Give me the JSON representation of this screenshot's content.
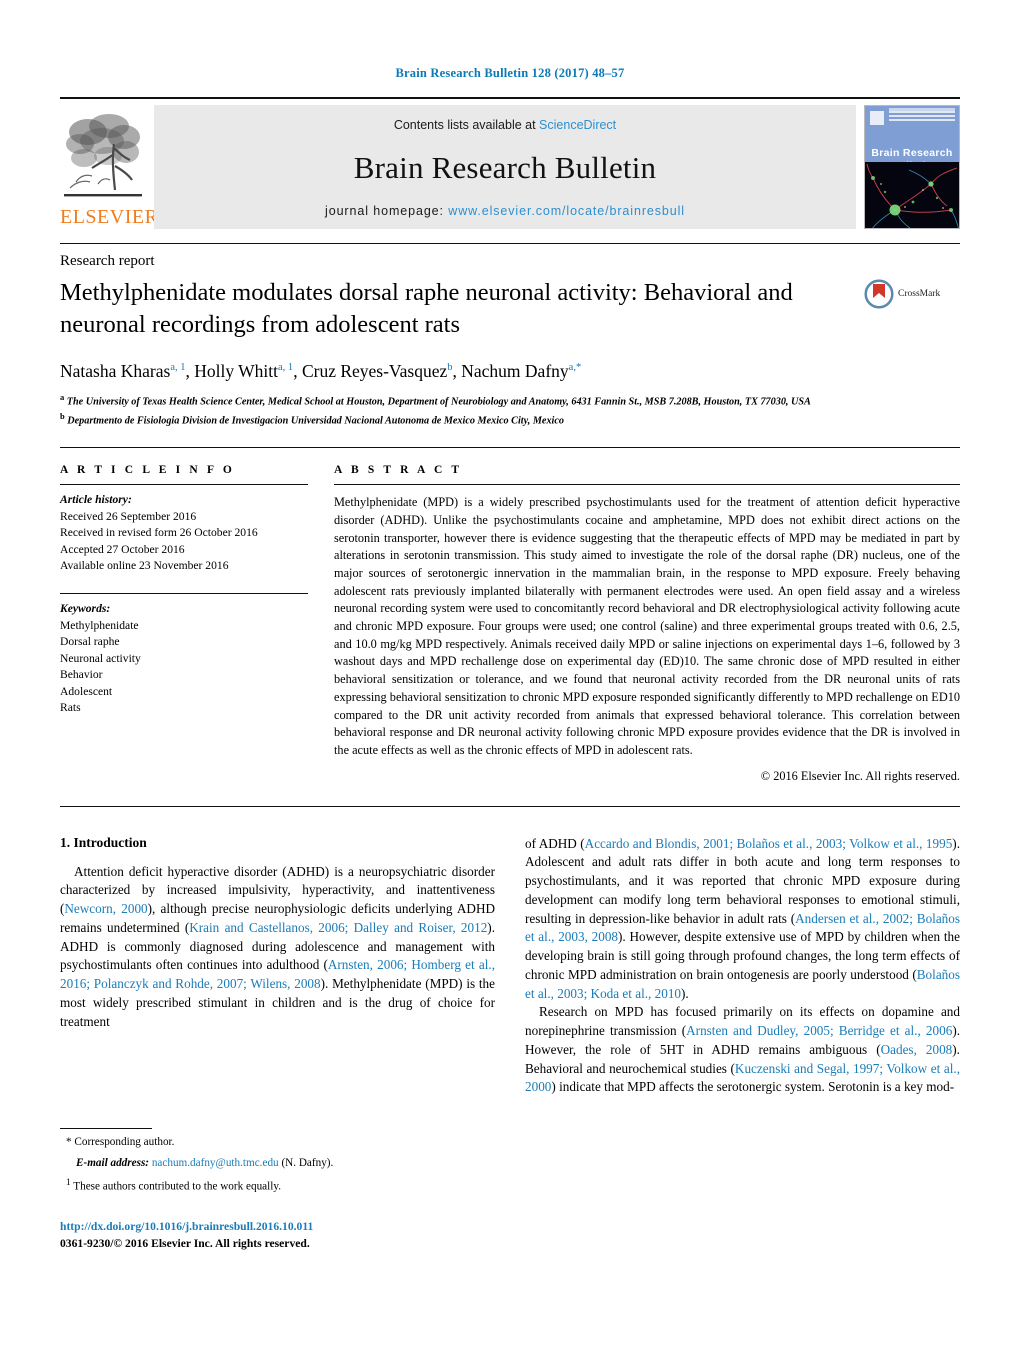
{
  "running_head": "Brain Research Bulletin 128 (2017) 48–57",
  "masthead": {
    "publisher_name": "ELSEVIER",
    "contents_prefix": "Contents lists available at ",
    "contents_link": "ScienceDirect",
    "journal_name": "Brain Research Bulletin",
    "homepage_prefix": "journal homepage: ",
    "homepage_url": "www.elsevier.com/locate/brainresbull",
    "cover_title": "Brain Research\nBulletin"
  },
  "article": {
    "type": "Research report",
    "title": "Methylphenidate modulates dorsal raphe neuronal activity: Behavioral and neuronal recordings from adolescent rats",
    "crossmark_label": "CrossMark",
    "authors_html": "Natasha Kharas<sup>a, 1</sup>, Holly Whitt<sup>a, 1</sup>, Cruz Reyes-Vasquez<sup>b</sup>, Nachum Dafny<sup>a,*</sup>",
    "affiliation_a": "The University of Texas Health Science Center, Medical School at Houston, Department of Neurobiology and Anatomy, 6431 Fannin St., MSB 7.208B, Houston, TX 77030, USA",
    "affiliation_b": "Departmento de Fisiologia Division de Investigacion Universidad Nacional Autonoma de Mexico Mexico City, Mexico"
  },
  "article_info": {
    "heading": "A R T I C L E    I N F O",
    "history_label": "Article history:",
    "history": [
      "Received 26 September 2016",
      "Received in revised form 26 October 2016",
      "Accepted 27 October 2016",
      "Available online 23 November 2016"
    ],
    "keywords_label": "Keywords:",
    "keywords": [
      "Methylphenidate",
      "Dorsal raphe",
      "Neuronal activity",
      "Behavior",
      "Adolescent",
      "Rats"
    ]
  },
  "abstract": {
    "heading": "A B S T R A C T",
    "text": "Methylphenidate (MPD) is a widely prescribed psychostimulants used for the treatment of attention deficit hyperactive disorder (ADHD). Unlike the psychostimulants cocaine and amphetamine, MPD does not exhibit direct actions on the serotonin transporter, however there is evidence suggesting that the therapeutic effects of MPD may be mediated in part by alterations in serotonin transmission. This study aimed to investigate the role of the dorsal raphe (DR) nucleus, one of the major sources of serotonergic innervation in the mammalian brain, in the response to MPD exposure. Freely behaving adolescent rats previously implanted bilaterally with permanent electrodes were used. An open field assay and a wireless neuronal recording system were used to concomitantly record behavioral and DR electrophysiological activity following acute and chronic MPD exposure. Four groups were used; one control (saline) and three experimental groups treated with 0.6, 2.5, and 10.0 mg/kg MPD respectively. Animals received daily MPD or saline injections on experimental days 1–6, followed by 3 washout days and MPD rechallenge dose on experimental day (ED)10. The same chronic dose of MPD resulted in either behavioral sensitization or tolerance, and we found that neuronal activity recorded from the DR neuronal units of rats expressing behavioral sensitization to chronic MPD exposure responded significantly differently to MPD rechallenge on ED10 compared to the DR unit activity recorded from animals that expressed behavioral tolerance. This correlation between behavioral response and DR neuronal activity following chronic MPD exposure provides evidence that the DR is involved in the acute effects as well as the chronic effects of MPD in adolescent rats.",
    "copyright": "© 2016 Elsevier Inc. All rights reserved."
  },
  "introduction": {
    "heading": "1.  Introduction",
    "left_paragraph_1": "Attention deficit hyperactive disorder (ADHD) is a neuropsychiatric disorder characterized by increased impulsivity, hyperactivity, and inattentiveness (Newcorn, 2000), although precise neurophysiologic deficits underlying ADHD remains undetermined (Krain and Castellanos, 2006; Dalley and Roiser, 2012). ADHD is commonly diagnosed during adolescence and management with psychostimulants often continues into adulthood (Arnsten, 2006; Homberg et al., 2016; Polanczyk and Rohde, 2007; Wilens, 2008). Methylphenidate (MPD) is the most widely prescribed stimulant in children and is the drug of choice for treatment",
    "right_paragraph_1": "of ADHD (Accardo and Blondis, 2001; Bolaños et al., 2003; Volkow et al., 1995). Adolescent and adult rats differ in both acute and long term responses to psychostimulants, and it was reported that chronic MPD exposure during development can modify long term behavioral responses to emotional stimuli, resulting in depression-like behavior in adult rats (Andersen et al., 2002; Bolaños et al., 2003, 2008). However, despite extensive use of MPD by children when the developing brain is still going through profound changes, the long term effects of chronic MPD administration on brain ontogenesis are poorly understood (Bolaños et al., 2003; Koda et al., 2010).",
    "right_paragraph_2": "Research on MPD has focused primarily on its effects on dopamine and norepinephrine transmission (Arnsten and Dudley, 2005; Berridge et al., 2006). However, the role of 5HT in ADHD remains ambiguous (Oades, 2008). Behavioral and neurochemical studies (Kuczenski and Segal, 1997; Volkow et al., 2000) indicate that MPD affects the serotonergic system. Serotonin is a key mod-"
  },
  "footnotes": {
    "corresponding_marker": "*",
    "corresponding_text": "Corresponding author.",
    "email_label": "E-mail address:",
    "email": "nachum.dafny@uth.tmc.edu",
    "email_suffix": "(N. Dafny).",
    "equal_marker": "1",
    "equal_text": "These authors contributed to the work equally."
  },
  "doi": {
    "url": "http://dx.doi.org/10.1016/j.brainresbull.2016.10.011",
    "issn_line": "0361-9230/© 2016 Elsevier Inc. All rights reserved."
  },
  "colors": {
    "link": "#1a7cb8",
    "running_head": "#0b7ab5",
    "elsevier_orange": "#f07c1f",
    "masthead_bg": "#e9e9e9",
    "cover_blue": "#7e9ed4"
  }
}
